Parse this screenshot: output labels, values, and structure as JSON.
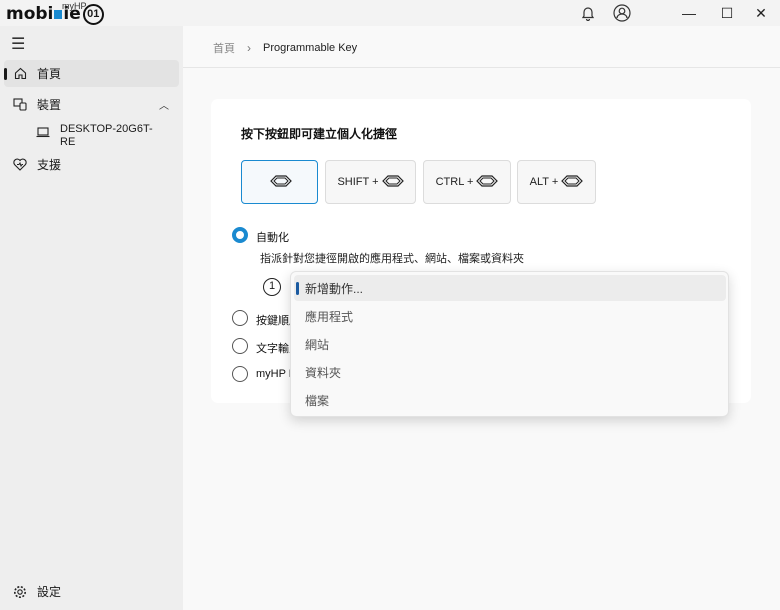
{
  "titlebar": {
    "logo_text_left": "mobi",
    "logo_text_right": "ie",
    "logo_circle": "01",
    "logo_small": "myHP",
    "notification_icon": "bell-icon",
    "account_icon": "user-icon",
    "minimize": "—",
    "maximize": "☐",
    "close": "✕"
  },
  "sidebar": {
    "menu_icon": "☰",
    "items": [
      {
        "label": "首頁",
        "icon": "home-icon"
      },
      {
        "label": "裝置",
        "icon": "devices-icon"
      },
      {
        "label": "支援",
        "icon": "support-icon"
      }
    ],
    "device_label": "DESKTOP-20G6T-RE",
    "settings_label": "設定"
  },
  "breadcrumb": {
    "home": "首頁",
    "separator": "›",
    "current": "Programmable Key"
  },
  "card": {
    "title": "按下按鈕即可建立個人化捷徑",
    "keys": [
      "",
      "SHIFT +",
      "CTRL +",
      "ALT +"
    ],
    "radios": [
      {
        "label": "自動化",
        "selected": true
      },
      {
        "label": "按鍵順序",
        "selected": false
      },
      {
        "label": "文字輸入",
        "selected": false
      },
      {
        "label": "myHP Pr",
        "selected": false
      }
    ],
    "hint": "指派針對您捷徑開啟的應用程式、網站、檔案或資料夾",
    "step_number": "1"
  },
  "dropdown": {
    "options": [
      "新增動作...",
      "應用程式",
      "網站",
      "資料夾",
      "檔案"
    ],
    "selected_index": 0
  },
  "colors": {
    "accent": "#1a8ad0"
  }
}
